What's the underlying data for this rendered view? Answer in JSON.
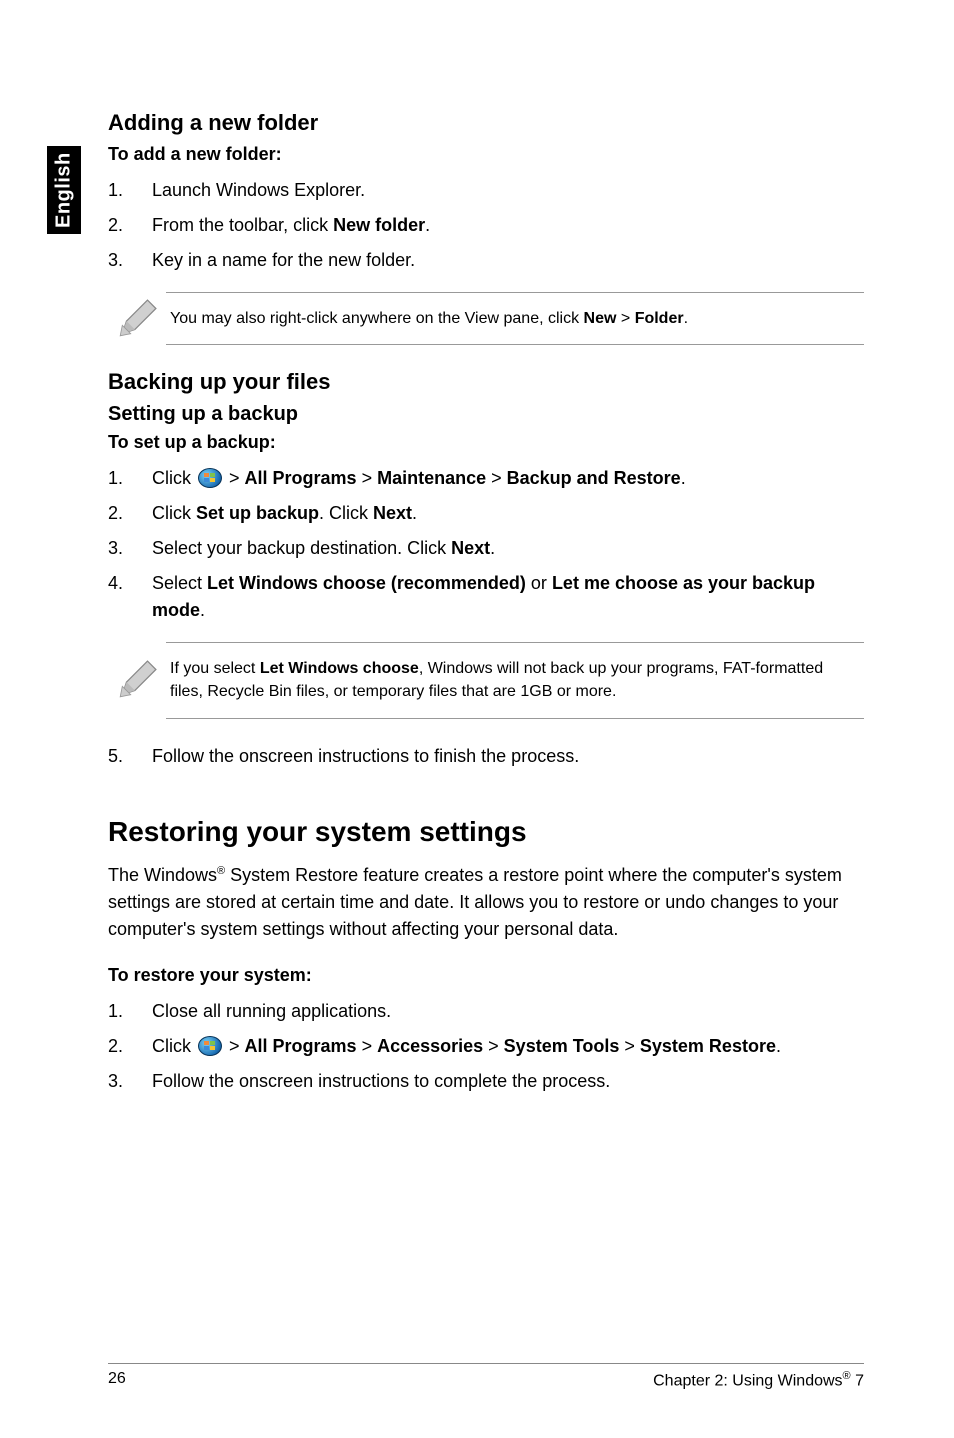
{
  "sideTab": "English",
  "sections": {
    "addFolder": {
      "title": "Adding a new folder",
      "lead": "To add a new folder:",
      "steps": [
        {
          "num": "1.",
          "text": "Launch Windows Explorer."
        },
        {
          "num": "2.",
          "pre": "From the toolbar, click ",
          "bold": "New folder",
          "post": "."
        },
        {
          "num": "3.",
          "text": "Key in a name for the new folder."
        }
      ],
      "note": {
        "pre": "You may also right-click anywhere on the View pane, click ",
        "b1": "New",
        "mid": " > ",
        "b2": "Folder",
        "post": "."
      }
    },
    "backup": {
      "title": "Backing up your files",
      "sub": "Setting up a backup",
      "lead": "To set up a backup:",
      "steps": [
        {
          "num": "1.",
          "pre": "Click ",
          "icon": true,
          "trail": " > ",
          "b1": "All Programs",
          "s1": " > ",
          "b2": "Maintenance",
          "s2": " > ",
          "b3": "Backup and Restore",
          "post": "."
        },
        {
          "num": "2.",
          "pre": "Click ",
          "b1": "Set up backup",
          "mid": ". Click ",
          "b2": "Next",
          "post": "."
        },
        {
          "num": "3.",
          "pre": "Select your backup destination. Click ",
          "b1": "Next",
          "post": "."
        },
        {
          "num": "4.",
          "pre": "Select ",
          "b1": "Let Windows choose (recommended)",
          "mid": " or ",
          "b2": "Let me choose as your backup mode",
          "post": "."
        }
      ],
      "note": {
        "pre": "If you select ",
        "b1": "Let Windows choose",
        "post": ", Windows will not back up your programs, FAT-formatted files, Recycle Bin files, or temporary files that are 1GB or more."
      },
      "step5": {
        "num": "5.",
        "text": "Follow the onscreen instructions to finish the process."
      }
    },
    "restore": {
      "title": "Restoring your system settings",
      "body": {
        "pre": "The Windows",
        "sup": "®",
        "post": " System Restore feature creates a restore point where the computer's system settings are stored at certain time and date. It allows you to restore or undo changes to your computer's system settings without affecting your personal data."
      },
      "lead": "To restore your system:",
      "steps": [
        {
          "num": "1.",
          "text": "Close all running applications."
        },
        {
          "num": "2.",
          "pre": "Click ",
          "icon": true,
          "trail": " > ",
          "b1": "All Programs",
          "s1": " > ",
          "b2": "Accessories",
          "s2": " > ",
          "b3": "System Tools",
          "s3": " > ",
          "b4": "System Restore",
          "post": "."
        },
        {
          "num": "3.",
          "text": "Follow the onscreen instructions to complete the process."
        }
      ]
    }
  },
  "footer": {
    "page": "26",
    "chapterPre": "Chapter 2: Using Windows",
    "sup": "®",
    "chapterPost": " 7"
  }
}
